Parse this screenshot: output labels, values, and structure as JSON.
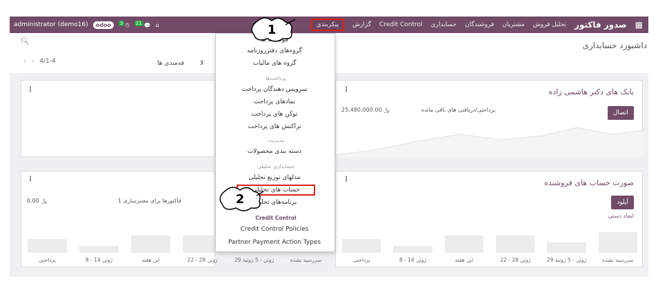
{
  "navbar": {
    "user": "administrator (demo16)",
    "logo": "odoo",
    "badge_activity": "3",
    "badge_messages": "21",
    "brand": "صدور فاکتور",
    "menu": [
      "تحلیل فروش",
      "مشتریان",
      "فروشندگان",
      "حسابداری",
      "Credit Control",
      "گزارش",
      "پیکربندی"
    ],
    "active_menu": "پیکربندی"
  },
  "control_panel": {
    "title": "داشبورد حسابداری",
    "pager": "4/1-4",
    "filter_a": "فه‌مندی ها",
    "filter_b": "لا"
  },
  "dropdown": {
    "items_top": [
      "موقعیت ها",
      "گروه‌های دفترروزنامه",
      "گروه های مالیات"
    ],
    "header_payments": "پرداخت‌ها",
    "items_payments": [
      "سرویس دهندگان پرداخت",
      "نمادهای پرداخت",
      "توکن های پرداخت",
      "تراکنش های پرداخت"
    ],
    "header_management": "مدیریت",
    "items_management": [
      "دسته بندی محصولات"
    ],
    "header_analytic": "حسابداری تحلیلی",
    "items_analytic": [
      "مدلهای توزیع تحلیلی",
      "حساب های تحلیلی",
      "برنامه‌های تحلیلی"
    ],
    "header_credit": "Credit Control",
    "items_credit": [
      "Credit Control Policies",
      "Partner Payment Action Types"
    ]
  },
  "callouts": {
    "one": "1",
    "two": "2"
  },
  "cards": {
    "bank": {
      "title": "بانک های دکتر هاشمی زاده",
      "button": "اتصال",
      "label": "پرداختی/دریافتی های باقی مانده",
      "amount": "25,480,000.00 ﷼"
    },
    "vendor": {
      "title": "صورت حساب های فروشنده",
      "button": "آپلود",
      "link": "ایجاد دستی"
    },
    "left_bottom": {
      "label": "1 فاکتورها برای معتبرسازی",
      "amount": "0.00 ﷼"
    },
    "axis_labels": [
      "سررسید نشده",
      "29 ژوئن - 5 ژوئیهٔ",
      "22 - 28 ژوئن",
      "این هفته",
      "8 - 14 ژوئن",
      "پرداختی"
    ]
  },
  "chart_data": {
    "type": "bar",
    "categories": [
      "سررسید نشده",
      "29 ژوئن - 5 ژوئیهٔ",
      "22 - 28 ژوئن",
      "این هفته",
      "8 - 14 ژوئن",
      "پرداختی"
    ],
    "values": [
      3,
      1.5,
      2.5,
      2.5,
      1,
      2
    ]
  }
}
